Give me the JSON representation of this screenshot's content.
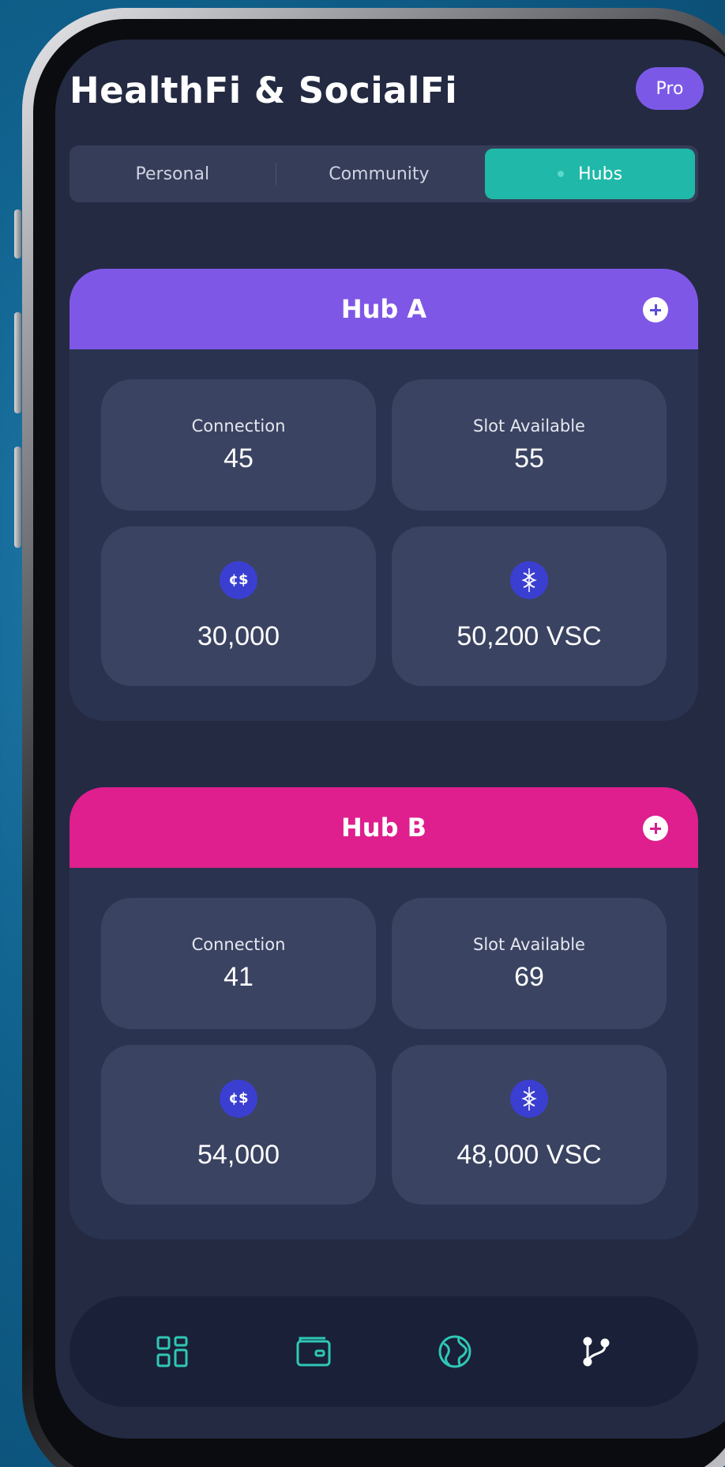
{
  "header": {
    "title": "HealthFi & SocialFi",
    "badge": "Pro"
  },
  "tabs": [
    {
      "label": "Personal",
      "active": false
    },
    {
      "label": "Community",
      "active": false
    },
    {
      "label": "Hubs",
      "active": true
    }
  ],
  "hubs": [
    {
      "name": "Hub A",
      "color": "#7f57e6",
      "connection_label": "Connection",
      "connection_value": "45",
      "slot_label": "Slot Available",
      "slot_value": "55",
      "coin_value": "30,000",
      "vsc_value": "50,200 VSC"
    },
    {
      "name": "Hub B",
      "color": "#de1f8d",
      "connection_label": "Connection",
      "connection_value": "41",
      "slot_label": "Slot Available",
      "slot_value": "69",
      "coin_value": "54,000",
      "vsc_value": "48,000 VSC"
    }
  ],
  "icons": {
    "coin_icon_text": "¢$",
    "nav": [
      "dashboard-icon",
      "wallet-icon",
      "globe-icon",
      "branch-icon"
    ]
  },
  "colors": {
    "accent": "#20b8a8",
    "pro": "#7b59e6",
    "background": "#232a42"
  }
}
